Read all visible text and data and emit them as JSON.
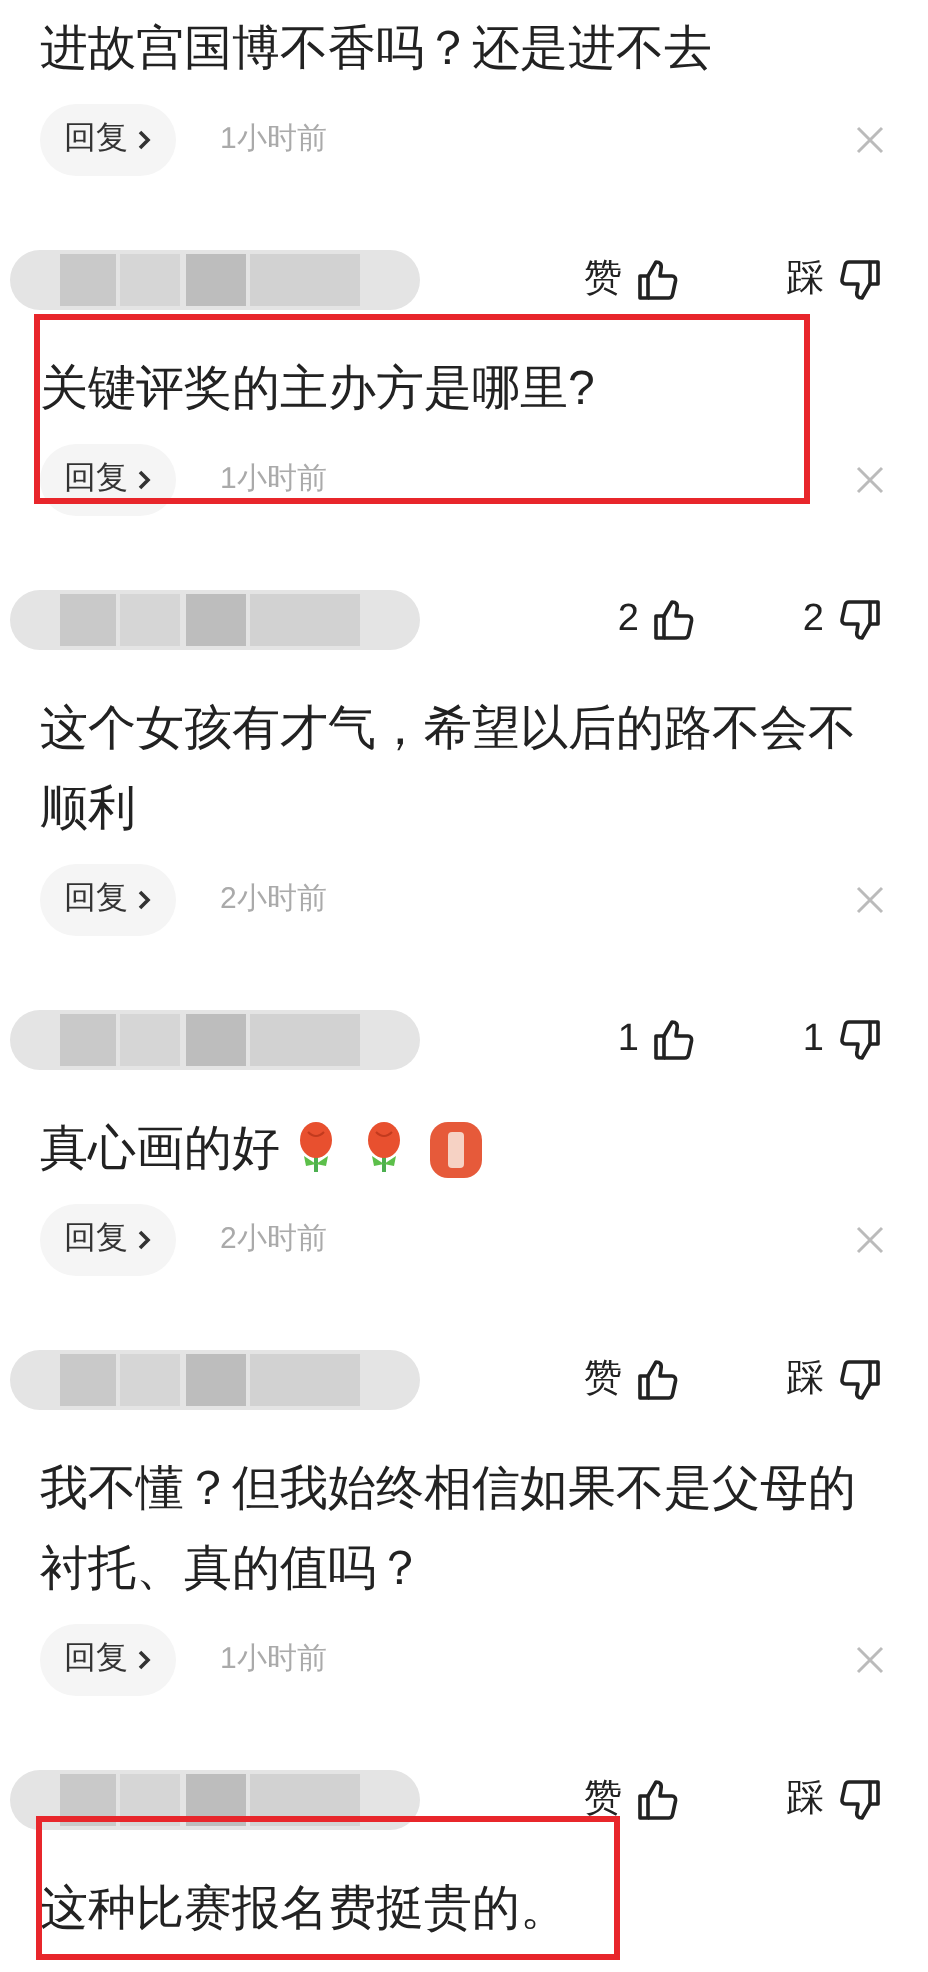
{
  "comments": [
    {
      "text": "进故宫国博不香吗？还是进不去",
      "reply": "回复",
      "time": "1小时前",
      "highlighted": false
    },
    {
      "like": "赞",
      "dislike": "踩",
      "text": "关键评奖的主办方是哪里?",
      "reply": "回复",
      "time": "1小时前",
      "highlighted": true
    },
    {
      "like": "2",
      "dislike": "2",
      "text": "这个女孩有才气，希望以后的路不会不顺利",
      "reply": "回复",
      "time": "2小时前",
      "highlighted": false
    },
    {
      "like": "1",
      "dislike": "1",
      "text": "真心画的好",
      "emojis": [
        {
          "kind": "flower"
        },
        {
          "kind": "flower"
        },
        {
          "kind": "sticker"
        }
      ],
      "reply": "回复",
      "time": "2小时前",
      "highlighted": false
    },
    {
      "like": "赞",
      "dislike": "踩",
      "text": "我不懂？但我始终相信如果不是父母的衬托、真的值吗？",
      "reply": "回复",
      "time": "1小时前",
      "highlighted": false
    },
    {
      "like": "赞",
      "dislike": "踩",
      "text": "这种比赛报名费挺贵的。",
      "highlighted": true
    }
  ]
}
